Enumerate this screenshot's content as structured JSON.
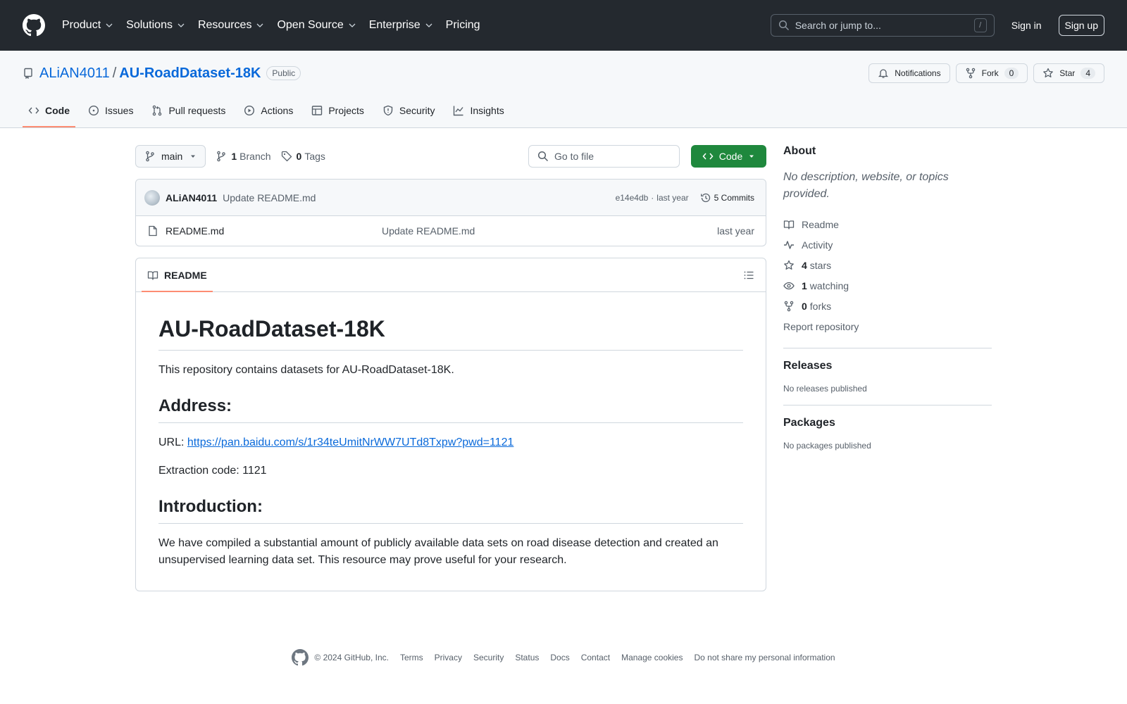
{
  "header": {
    "nav": [
      {
        "label": "Product",
        "dropdown": true
      },
      {
        "label": "Solutions",
        "dropdown": true
      },
      {
        "label": "Resources",
        "dropdown": true
      },
      {
        "label": "Open Source",
        "dropdown": true
      },
      {
        "label": "Enterprise",
        "dropdown": true
      },
      {
        "label": "Pricing",
        "dropdown": false
      }
    ],
    "search_placeholder": "Search or jump to...",
    "search_shortcut": "/",
    "signin": "Sign in",
    "signup": "Sign up"
  },
  "repo": {
    "owner": "ALiAN4011",
    "separator": "/",
    "name": "AU-RoadDataset-18K",
    "visibility": "Public",
    "notifications": "Notifications",
    "fork_label": "Fork",
    "fork_count": "0",
    "star_label": "Star",
    "star_count": "4",
    "tabs": [
      {
        "label": "Code",
        "icon": "code-icon",
        "active": true
      },
      {
        "label": "Issues",
        "icon": "issue-icon",
        "active": false
      },
      {
        "label": "Pull requests",
        "icon": "pull-request-icon",
        "active": false
      },
      {
        "label": "Actions",
        "icon": "play-icon",
        "active": false
      },
      {
        "label": "Projects",
        "icon": "table-icon",
        "active": false
      },
      {
        "label": "Security",
        "icon": "shield-icon",
        "active": false
      },
      {
        "label": "Insights",
        "icon": "graph-icon",
        "active": false
      }
    ]
  },
  "toolbar": {
    "branch": "main",
    "branch_count": "1",
    "branch_label": "Branch",
    "tag_count": "0",
    "tag_label": "Tags",
    "goto_placeholder": "Go to file",
    "code_button": "Code"
  },
  "commit": {
    "author": "ALiAN4011",
    "message": "Update README.md",
    "hash": "e14e4db",
    "dot": "·",
    "time": "last year",
    "commits": "5 Commits"
  },
  "files": [
    {
      "name": "README.md",
      "message": "Update README.md",
      "time": "last year"
    }
  ],
  "readme": {
    "tab": "README",
    "title": "AU-RoadDataset-18K",
    "intro": "This repository contains datasets for AU-RoadDataset-18K.",
    "address_heading": "Address:",
    "url_prefix": "URL: ",
    "url": "https://pan.baidu.com/s/1r34teUmitNrWW7UTd8Txpw?pwd=1121",
    "extraction": "Extraction code: 1121",
    "intro_heading": "Introduction:",
    "intro_text": "We have compiled a substantial amount of publicly available data sets on road disease detection and created an unsupervised learning data set. This resource may prove useful for your research."
  },
  "sidebar": {
    "about_heading": "About",
    "about_desc": "No description, website, or topics provided.",
    "readme": "Readme",
    "activity": "Activity",
    "stars_count": "4",
    "stars_label": "stars",
    "watching_count": "1",
    "watching_label": "watching",
    "forks_count": "0",
    "forks_label": "forks",
    "report": "Report repository",
    "releases_heading": "Releases",
    "releases_text": "No releases published",
    "packages_heading": "Packages",
    "packages_text": "No packages published"
  },
  "footer": {
    "copyright": "© 2024 GitHub, Inc.",
    "links": [
      "Terms",
      "Privacy",
      "Security",
      "Status",
      "Docs",
      "Contact",
      "Manage cookies",
      "Do not share my personal information"
    ]
  },
  "colors": {
    "header_bg": "#24292f",
    "link": "#0969da",
    "code_button": "#1f883d",
    "active_tab": "#fd8c73"
  }
}
